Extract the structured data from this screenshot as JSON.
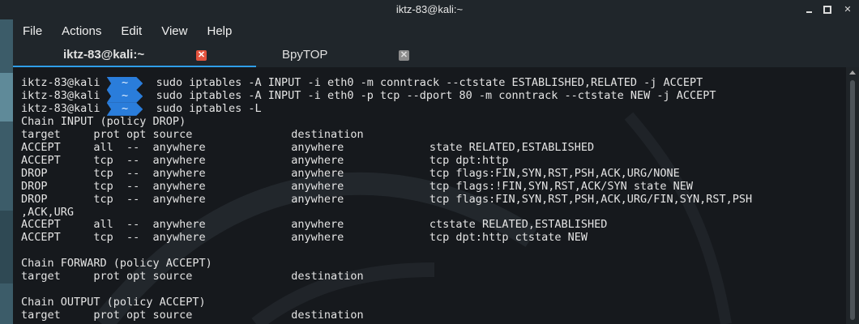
{
  "window": {
    "title": "iktz-83@kali:~",
    "controls": [
      "minimize-icon",
      "maximize-icon",
      "close-icon"
    ]
  },
  "menu": [
    "File",
    "Actions",
    "Edit",
    "View",
    "Help"
  ],
  "tabs": [
    {
      "label": "iktz-83@kali:~",
      "active": true,
      "close_glyph": "✕"
    },
    {
      "label": "BpyTOP",
      "active": false,
      "close_glyph": "✕"
    }
  ],
  "terminal": {
    "prompt_user": "iktz-83@kali",
    "prompt_dir": "~",
    "commands": [
      "sudo iptables -A INPUT -i eth0 -m conntrack --ctstate ESTABLISHED,RELATED -j ACCEPT",
      "sudo iptables -A INPUT -i eth0 -p tcp --dport 80 -m conntrack --ctstate NEW -j ACCEPT",
      "sudo iptables -L"
    ],
    "output": [
      "Chain INPUT (policy DROP)",
      "target     prot opt source               destination",
      "ACCEPT     all  --  anywhere             anywhere             state RELATED,ESTABLISHED",
      "ACCEPT     tcp  --  anywhere             anywhere             tcp dpt:http",
      "DROP       tcp  --  anywhere             anywhere             tcp flags:FIN,SYN,RST,PSH,ACK,URG/NONE",
      "DROP       tcp  --  anywhere             anywhere             tcp flags:!FIN,SYN,RST,ACK/SYN state NEW",
      "DROP       tcp  --  anywhere             anywhere             tcp flags:FIN,SYN,RST,PSH,ACK,URG/FIN,SYN,RST,PSH",
      ",ACK,URG",
      "ACCEPT     all  --  anywhere             anywhere             ctstate RELATED,ESTABLISHED",
      "ACCEPT     tcp  --  anywhere             anywhere             tcp dpt:http ctstate NEW",
      "",
      "Chain FORWARD (policy ACCEPT)",
      "target     prot opt source               destination",
      "",
      "Chain OUTPUT (policy ACCEPT)",
      "target     prot opt source               destination"
    ]
  },
  "colors": {
    "prompt_dir_bg": "#2a7ddb",
    "active_tab_underline": "#2f9ee8",
    "tab_close_active": "#e3533e"
  }
}
